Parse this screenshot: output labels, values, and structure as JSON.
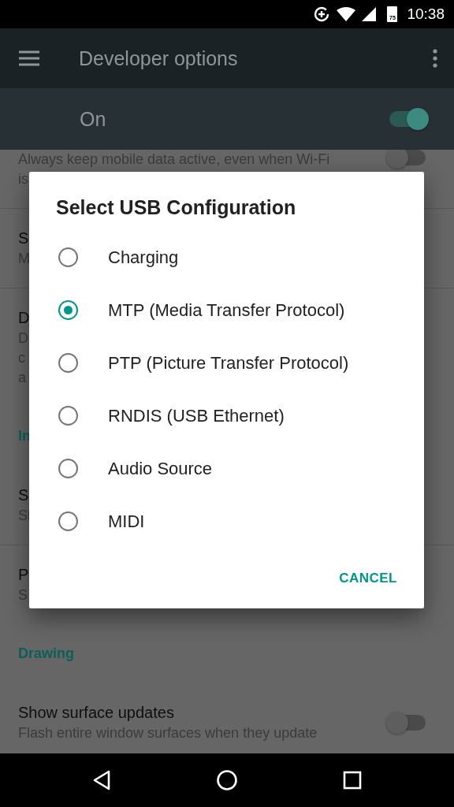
{
  "status_bar": {
    "battery": "75",
    "time": "10:38"
  },
  "app_bar": {
    "title": "Developer options"
  },
  "master_switch": {
    "label": "On",
    "on": true
  },
  "settings": [
    {
      "kind": "setting",
      "lines": [
        "Always keep mobile data active, even when Wi-Fi",
        "is"
      ],
      "toggle": {
        "on": false
      }
    },
    {
      "kind": "setting",
      "lines": [
        "S",
        "M"
      ]
    },
    {
      "kind": "setting",
      "lines": [
        "D",
        "D",
        "c",
        "a"
      ]
    },
    {
      "kind": "header",
      "lines": [
        "In"
      ]
    },
    {
      "kind": "setting",
      "lines": [
        "S",
        "Sl"
      ]
    },
    {
      "kind": "setting",
      "lines": [
        "P",
        "S"
      ]
    },
    {
      "kind": "header",
      "lines": [
        "Drawing"
      ]
    },
    {
      "kind": "setting",
      "lines": [
        "Show surface updates",
        "Flash entire window surfaces when they update"
      ],
      "toggle": {
        "on": false
      }
    }
  ],
  "dialog": {
    "title": "Select USB Configuration",
    "options": [
      {
        "label": "Charging",
        "selected": false
      },
      {
        "label": "MTP (Media Transfer Protocol)",
        "selected": true
      },
      {
        "label": "PTP (Picture Transfer Protocol)",
        "selected": false
      },
      {
        "label": "RNDIS (USB Ethernet)",
        "selected": false
      },
      {
        "label": "Audio Source",
        "selected": false
      },
      {
        "label": "MIDI",
        "selected": false
      }
    ],
    "button": "CANCEL"
  }
}
